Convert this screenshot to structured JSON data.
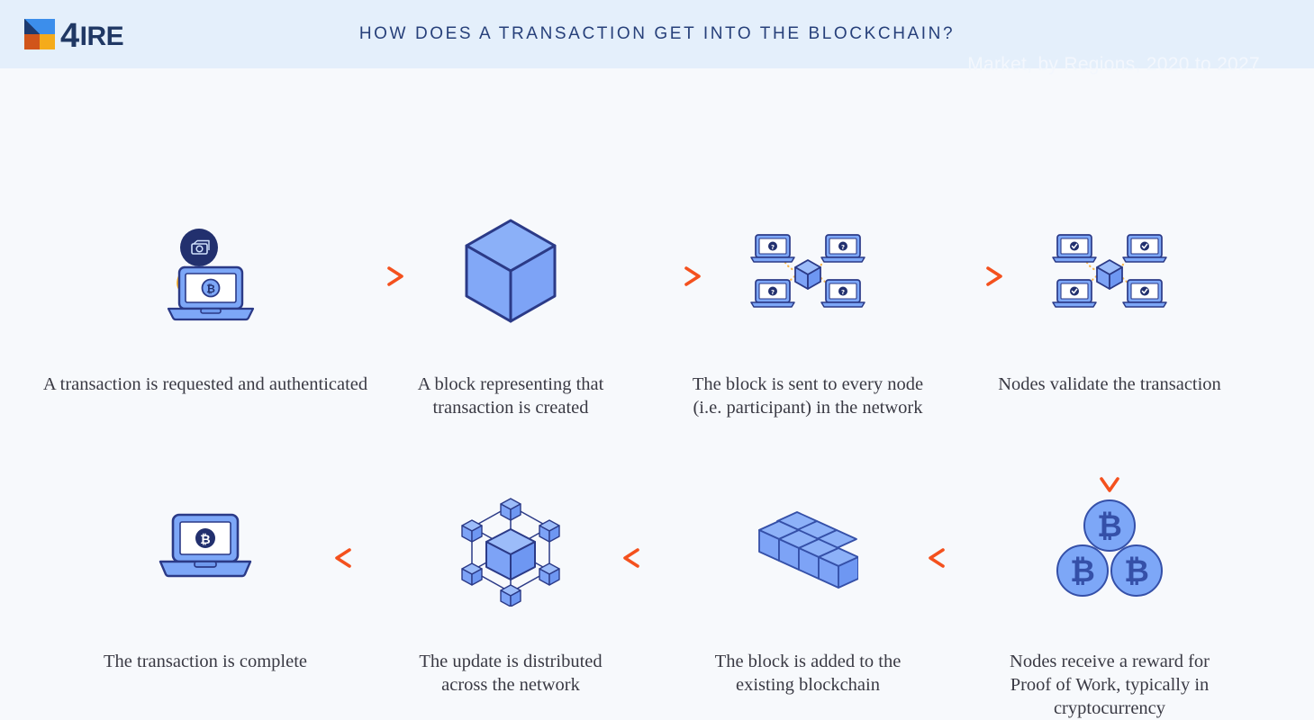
{
  "header": {
    "logo": {
      "mark_name": "4ire-logo-mark",
      "four": "4",
      "text": "IRE",
      "colors": {
        "blue": "#3C8EEB",
        "navy": "#1E3A6E",
        "orange": "#D1551A",
        "amber": "#F5AB1B"
      }
    },
    "title": "HOW DOES A TRANSACTION GET INTO THE BLOCKCHAIN?",
    "background": "#E4EFFB",
    "title_color": "#27407A"
  },
  "ghost_text": "Market, by Regions, 2020 to 2027",
  "theme": {
    "page_background": "#F7F9FC",
    "icon_light_blue": "#7DA7F7",
    "icon_navy": "#2B3A87",
    "arrow_orange_start": "#F7A600",
    "arrow_orange_end": "#F4511E",
    "caption_color": "#3A3A44"
  },
  "steps": [
    {
      "index": 1,
      "icon": "transaction-request-laptop-icon",
      "caption": "A transaction is requested and authenticated",
      "row": 1,
      "column": 1
    },
    {
      "index": 2,
      "icon": "single-block-cube-icon",
      "caption": "A block representing that\ntransaction is created",
      "row": 1,
      "column": 2
    },
    {
      "index": 3,
      "icon": "block-broadcast-network-icon",
      "caption": "The block is sent to every node\n(i.e. participant) in the network",
      "row": 1,
      "column": 3
    },
    {
      "index": 4,
      "icon": "nodes-validate-network-icon",
      "caption": "Nodes validate the transaction",
      "row": 1,
      "column": 4
    },
    {
      "index": 5,
      "icon": "bitcoin-reward-coins-icon",
      "caption": "Nodes receive a reward for\nProof of Work, typically in\ncryptocurrency",
      "row": 2,
      "column": 4
    },
    {
      "index": 6,
      "icon": "blockchain-blocks-row-icon",
      "caption": "The block is added to the\nexisting blockchain",
      "row": 2,
      "column": 3
    },
    {
      "index": 7,
      "icon": "distributed-network-cubes-icon",
      "caption": "The update is distributed\nacross the network",
      "row": 2,
      "column": 2
    },
    {
      "index": 8,
      "icon": "transaction-complete-laptop-icon",
      "caption": "The transaction is complete",
      "row": 2,
      "column": 1
    }
  ],
  "arrows": [
    {
      "name": "arrow-step1-to-step2",
      "direction": "right"
    },
    {
      "name": "arrow-step2-to-step3",
      "direction": "right"
    },
    {
      "name": "arrow-step3-to-step4",
      "direction": "right"
    },
    {
      "name": "arrow-step4-to-step5",
      "direction": "down"
    },
    {
      "name": "arrow-step5-to-step6",
      "direction": "left"
    },
    {
      "name": "arrow-step6-to-step7",
      "direction": "left"
    },
    {
      "name": "arrow-step7-to-step8",
      "direction": "left"
    }
  ]
}
